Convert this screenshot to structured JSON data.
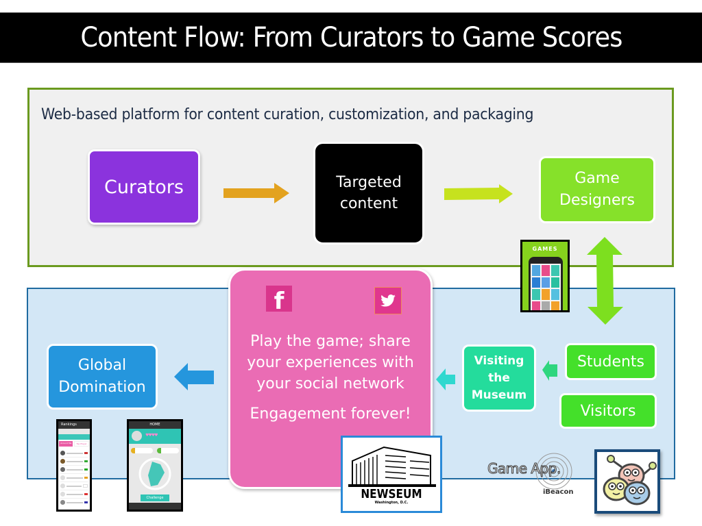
{
  "slide": {
    "title": "Content Flow: From Curators to Game Scores"
  },
  "platform_panel": {
    "subtitle": "Web-based platform for content curation, customization, and packaging",
    "border_color": "#6b9a1f",
    "nodes": {
      "curators": "Curators",
      "targeted_line1": "Targeted",
      "targeted_line2": "content",
      "designers_line1": "Game",
      "designers_line2": "Designers"
    }
  },
  "app_panel": {
    "border_color": "#1f6aa0",
    "engagement": {
      "line1": "Play the game; share",
      "line2": "your experiences with",
      "line3": "your social network",
      "line4": "Engagement forever!",
      "icons": [
        "facebook-icon",
        "twitter-icon"
      ]
    },
    "nodes": {
      "global_line1": "Global",
      "global_line2": "Domination",
      "museum_line1": "Visiting",
      "museum_line2": "the",
      "museum_line3": "Museum",
      "students": "Students",
      "visitors": "Visitors"
    },
    "game_app_label": "Game App.",
    "ibeacon_label": "iBeacon",
    "newseum": {
      "name": "NEWSEUM",
      "location": "Washington, D.C."
    },
    "games_phone_label": "GAMES",
    "rankings_phone": {
      "header": "Rankings",
      "buttons": [
        "Around Me",
        "Top Player"
      ]
    },
    "home_phone": {
      "header": "HOME",
      "button": "Challenge"
    }
  },
  "colors": {
    "curators": "#8b33dd",
    "targeted": "#000000",
    "designers": "#86e12a",
    "engagement": "#ea6cb4",
    "global": "#2596dd",
    "museum": "#24dc9c",
    "students": "#44e02a",
    "arrow_orange": "#e3a21f",
    "arrow_lime": "#c6e21e",
    "arrow_green": "#7ddf1f"
  }
}
